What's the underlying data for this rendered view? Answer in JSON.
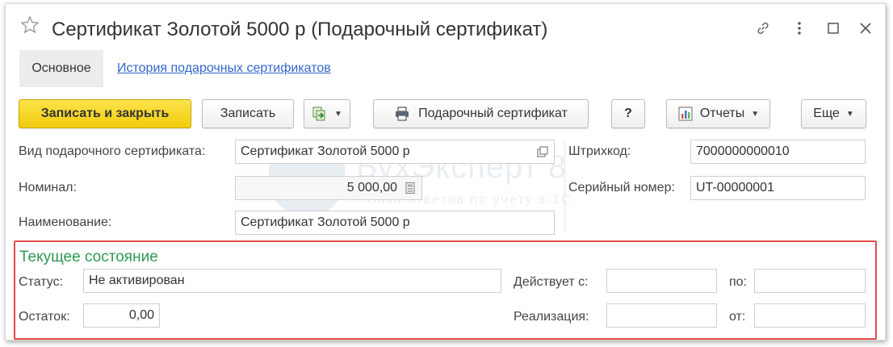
{
  "window": {
    "title": "Сертификат Золотой 5000 р (Подарочный сертификат)"
  },
  "nav": {
    "main_tab": "Основное",
    "history_link": "История подарочных сертификатов"
  },
  "toolbar": {
    "save_close_label": "Записать и закрыть",
    "save_label": "Записать",
    "print_label": "Подарочный сертификат",
    "help_label": "?",
    "reports_label": "Отчеты",
    "more_label": "Еще"
  },
  "form": {
    "type_label": "Вид подарочного сертификата:",
    "type_value": "Сертификат Золотой 5000 р",
    "nominal_label": "Номинал:",
    "nominal_value": "5 000,00",
    "name_label": "Наименование:",
    "name_value": "Сертификат Золотой 5000 р",
    "barcode_label": "Штрихкод:",
    "barcode_value": "7000000000010",
    "serial_label": "Серийный номер:",
    "serial_value": "UT-00000001"
  },
  "watermark": {
    "title": "БухЭксперт 8",
    "subtitle": "База ответов по учету в 1С"
  },
  "state": {
    "title": "Текущее состояние",
    "status_label": "Статус:",
    "status_value": "Не активирован",
    "balance_label": "Остаток:",
    "balance_value": "0,00",
    "valid_from_label": "Действует с:",
    "valid_from_value": " .  .",
    "valid_to_label": "по:",
    "valid_to_value": " .  .",
    "sale_label": "Реализация:",
    "sale_value": "",
    "sale_date_label": "от:",
    "sale_date_value": " .  ."
  },
  "colors": {
    "primary_button": "#f5d31c",
    "link": "#3366cc",
    "section_title": "#2e9a52",
    "highlight_frame": "#e24a4a"
  },
  "icons": {
    "favorite": "star-icon",
    "link": "link-icon",
    "menu": "more-vertical-icon",
    "maximize": "maximize-icon",
    "close": "close-icon",
    "create_based_on": "create-based-on-icon",
    "print": "printer-icon",
    "reports": "report-icon",
    "open": "open-icon",
    "calculator": "calculator-icon"
  }
}
